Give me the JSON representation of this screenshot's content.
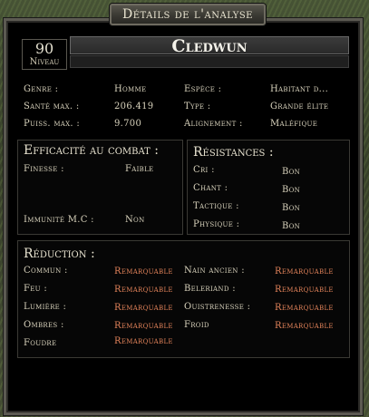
{
  "window": {
    "title": "Détails de l'analyse"
  },
  "character": {
    "level": "90",
    "level_label": "Niveau",
    "name": "Cledwun"
  },
  "stats": {
    "genre_label": "Genre :",
    "genre_value": "Homme",
    "espece_label": "Espèce :",
    "espece_value": "Habitant d...",
    "sante_label": "Santé max. :",
    "sante_value": "206.419",
    "type_label": "Type :",
    "type_value": "Grande élite",
    "puiss_label": "Puiss. max. :",
    "puiss_value": "9.700",
    "align_label": "Alignement :",
    "align_value": "Maléfique"
  },
  "efficacite": {
    "title": "Efficacité au combat :",
    "finesse_label": "Finesse :",
    "finesse_value": "Faible",
    "immunite_label": "Immunité M.C :",
    "immunite_value": "Non"
  },
  "resistances": {
    "title": "Résistances :",
    "rows": [
      {
        "label": "Cri :",
        "value": "Bon"
      },
      {
        "label": "Chant :",
        "value": "Bon"
      },
      {
        "label": "Tactique :",
        "value": "Bon"
      },
      {
        "label": "Physique :",
        "value": "Bon"
      }
    ]
  },
  "reduction": {
    "title": "Réduction :",
    "left": [
      {
        "label": "Commun :",
        "value": "Remarquable"
      },
      {
        "label": "Feu :",
        "value": "Remarquable"
      },
      {
        "label": "Lumière :",
        "value": "Remarquable"
      },
      {
        "label": "Ombres :",
        "value": "Remarquable"
      },
      {
        "label": "Foudre",
        "value": "Remarquable"
      }
    ],
    "right": [
      {
        "label": "Nain ancien :",
        "value": "Remarquable"
      },
      {
        "label": "Beleriand :",
        "value": "Remarquable"
      },
      {
        "label": "Ouistrenesse :",
        "value": "Remarquable"
      },
      {
        "label": "Froid",
        "value": "Remarquable"
      }
    ]
  },
  "colors": {
    "remarkable": "#e2835a",
    "text": "#d8d2bc",
    "background": "#000000"
  }
}
